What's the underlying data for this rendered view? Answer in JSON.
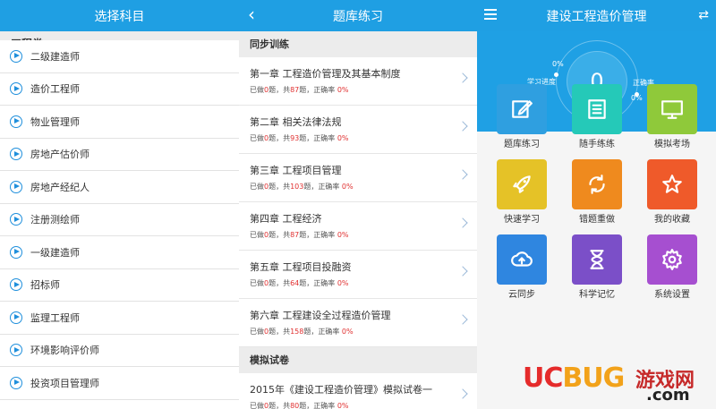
{
  "panel1": {
    "title": "选择科目",
    "category": "工程类",
    "subjects": [
      "二级建造师",
      "造价工程师",
      "物业管理师",
      "房地产估价师",
      "房地产经纪人",
      "注册测绘师",
      "一级建造师",
      "招标师",
      "监理工程师",
      "环境影响评价师",
      "投资项目管理师"
    ]
  },
  "panel2": {
    "title": "题库练习",
    "section1": "同步训练",
    "chapters": [
      {
        "title": "第一章  工程造价管理及其基本制度",
        "done": "已做",
        "done_n": "0",
        "mid": "题，共",
        "total": "87",
        "tail": "题，正确率 ",
        "rate": "0%"
      },
      {
        "title": "第二章  相关法律法规",
        "done": "已做",
        "done_n": "0",
        "mid": "题，共",
        "total": "93",
        "tail": "题，正确率 ",
        "rate": "0%"
      },
      {
        "title": "第三章  工程项目管理",
        "done": "已做",
        "done_n": "0",
        "mid": "题，共",
        "total": "103",
        "tail": "题，正确率 ",
        "rate": "0%"
      },
      {
        "title": "第四章  工程经济",
        "done": "已做",
        "done_n": "0",
        "mid": "题，共",
        "total": "87",
        "tail": "题，正确率 ",
        "rate": "0%"
      },
      {
        "title": "第五章  工程项目投融资",
        "done": "已做",
        "done_n": "0",
        "mid": "题，共",
        "total": "64",
        "tail": "题，正确率 ",
        "rate": "0%"
      },
      {
        "title": "第六章  工程建设全过程造价管理",
        "done": "已做",
        "done_n": "0",
        "mid": "题，共",
        "total": "158",
        "tail": "题，正确率 ",
        "rate": "0%"
      }
    ],
    "section2": "模拟试卷",
    "exam": {
      "title": "2015年《建设工程造价管理》模拟试卷一",
      "done": "已做",
      "done_n": "0",
      "mid": "题，共",
      "total": "80",
      "tail": "题，正确率 ",
      "rate": "0%"
    }
  },
  "panel3": {
    "title": "建设工程造价管理",
    "score": "0",
    "progress_label": "学习进度",
    "progress_value": "0%",
    "accuracy_label": "正确率",
    "accuracy_value": "0%",
    "tiles": [
      {
        "label": "题库练习",
        "color": "#2f9fe0",
        "icon": "edit-icon"
      },
      {
        "label": "随手练练",
        "color": "#25c9b8",
        "icon": "list-icon"
      },
      {
        "label": "模拟考场",
        "color": "#8fc93a",
        "icon": "monitor-icon"
      },
      {
        "label": "快速学习",
        "color": "#e5c227",
        "icon": "rocket-icon"
      },
      {
        "label": "错题重做",
        "color": "#ef8a1e",
        "icon": "refresh-icon"
      },
      {
        "label": "我的收藏",
        "color": "#ef5a2a",
        "icon": "star-icon"
      },
      {
        "label": "云同步",
        "color": "#2f86e0",
        "icon": "cloud-upload-icon"
      },
      {
        "label": "科学记忆",
        "color": "#7b4fc8",
        "icon": "hourglass-icon"
      },
      {
        "label": "系统设置",
        "color": "#a64fd0",
        "icon": "gear-icon"
      }
    ]
  },
  "watermark": {
    "uc": "UC",
    "bug": "BUG",
    "cn": "游戏网",
    "com": ".com"
  }
}
